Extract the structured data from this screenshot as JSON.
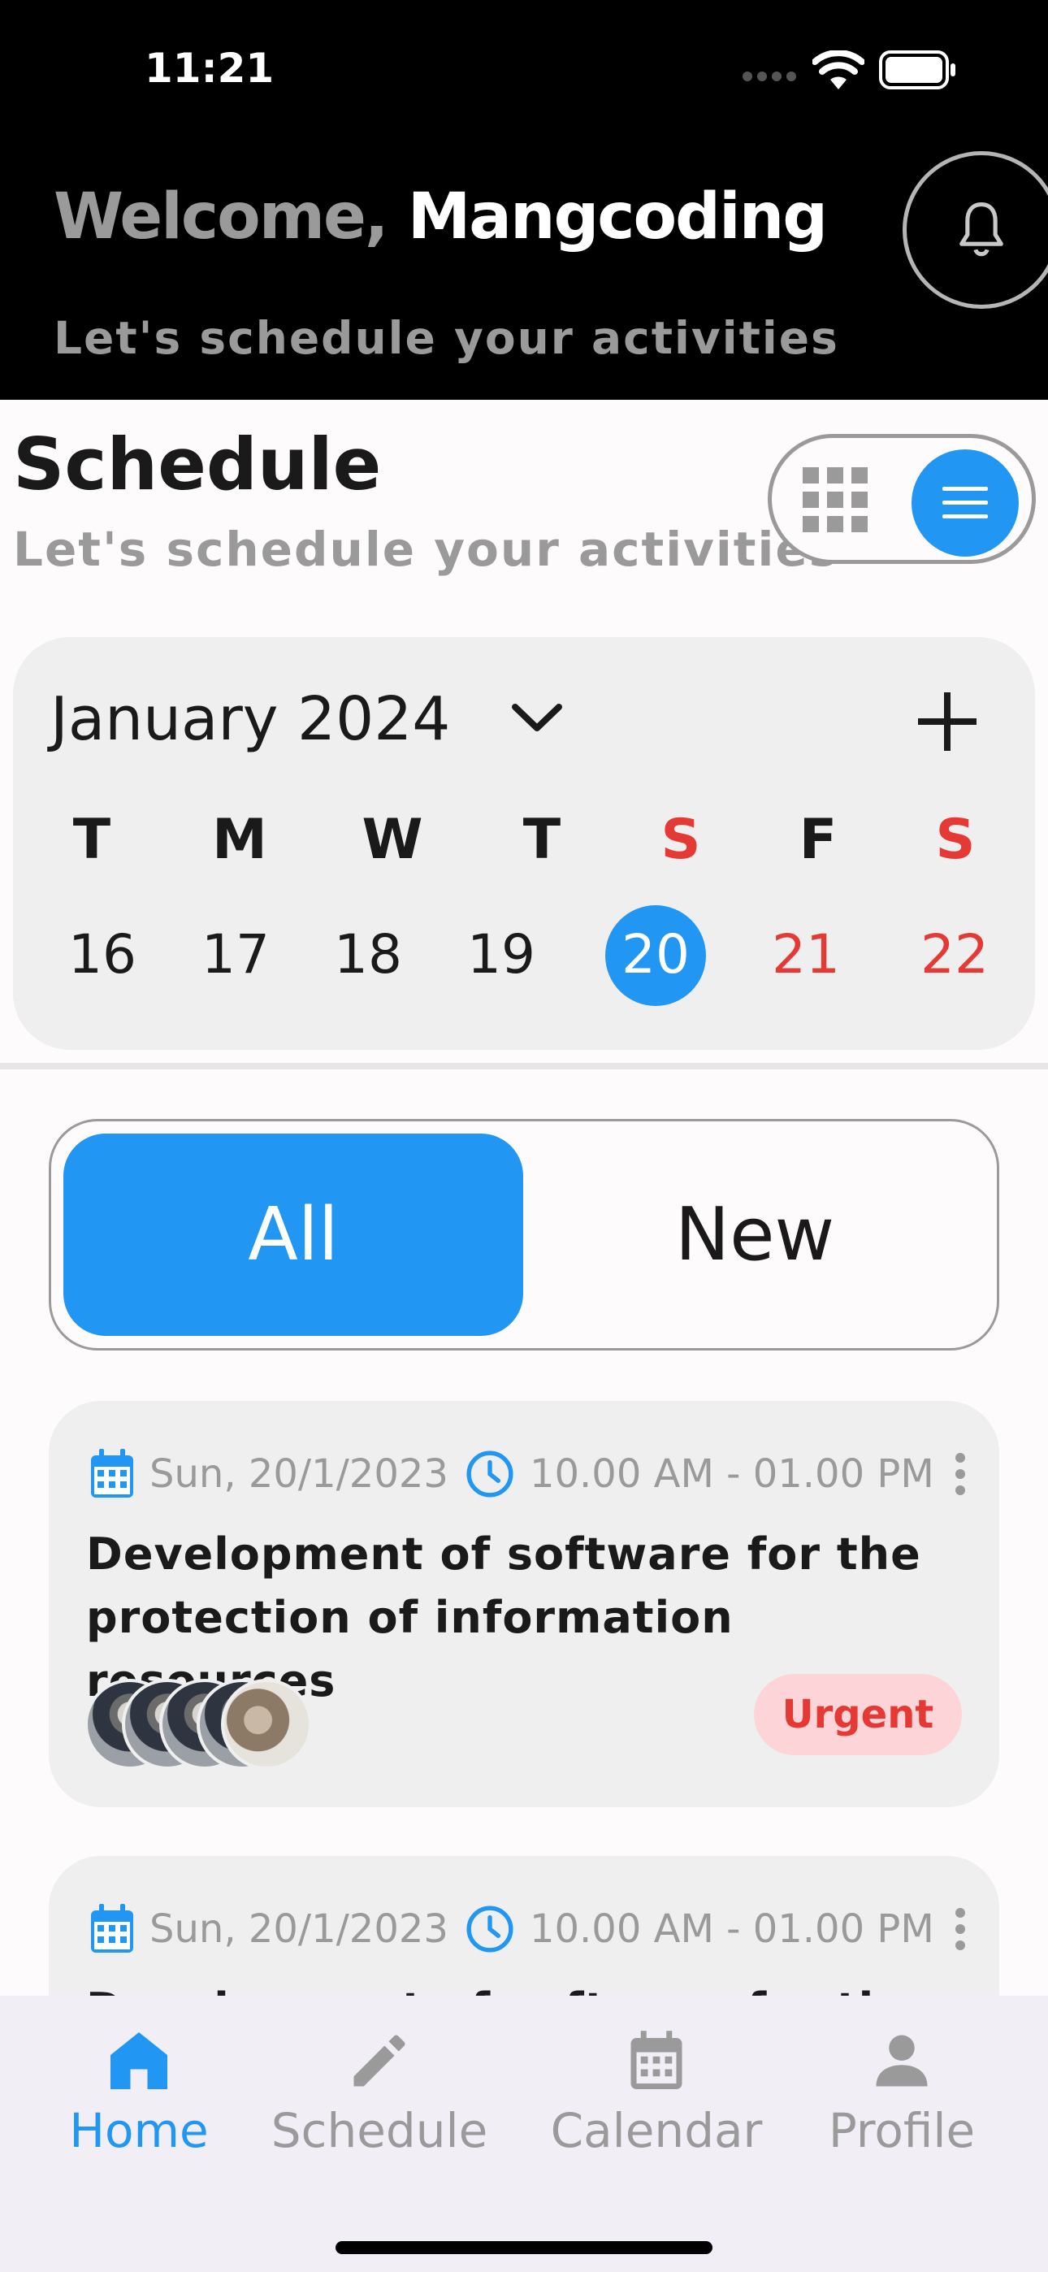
{
  "status_bar": {
    "time": "11:21"
  },
  "header": {
    "greeting": "Welcome,",
    "user_name": "Mangcoding",
    "subtitle": "Let's schedule your activities"
  },
  "schedule": {
    "title": "Schedule",
    "subtitle": "Let's schedule your activities",
    "view_mode": "list"
  },
  "calendar": {
    "month_label": "January 2024",
    "weekdays": [
      "T",
      "M",
      "W",
      "T",
      "S",
      "F",
      "S"
    ],
    "days": [
      "16",
      "17",
      "18",
      "19",
      "20",
      "21",
      "22"
    ],
    "selected_day": "20"
  },
  "filter": {
    "all_label": "All",
    "new_label": "New",
    "selected": "All"
  },
  "tasks": [
    {
      "date": "Sun, 20/1/2023",
      "time": "10.00 AM - 01.00 PM",
      "title": "Development of software for the protection of information resources",
      "badge": "Urgent"
    },
    {
      "date": "Sun, 20/1/2023",
      "time": "10.00 AM - 01.00 PM",
      "title": "Development of software for the protection of information resources"
    }
  ],
  "nav": {
    "home": "Home",
    "schedule": "Schedule",
    "calendar": "Calendar",
    "profile": "Profile",
    "active": "Home"
  },
  "colors": {
    "accent": "#2196f3",
    "weekend": "#e53935",
    "urgent_bg": "#fdd5d8"
  }
}
